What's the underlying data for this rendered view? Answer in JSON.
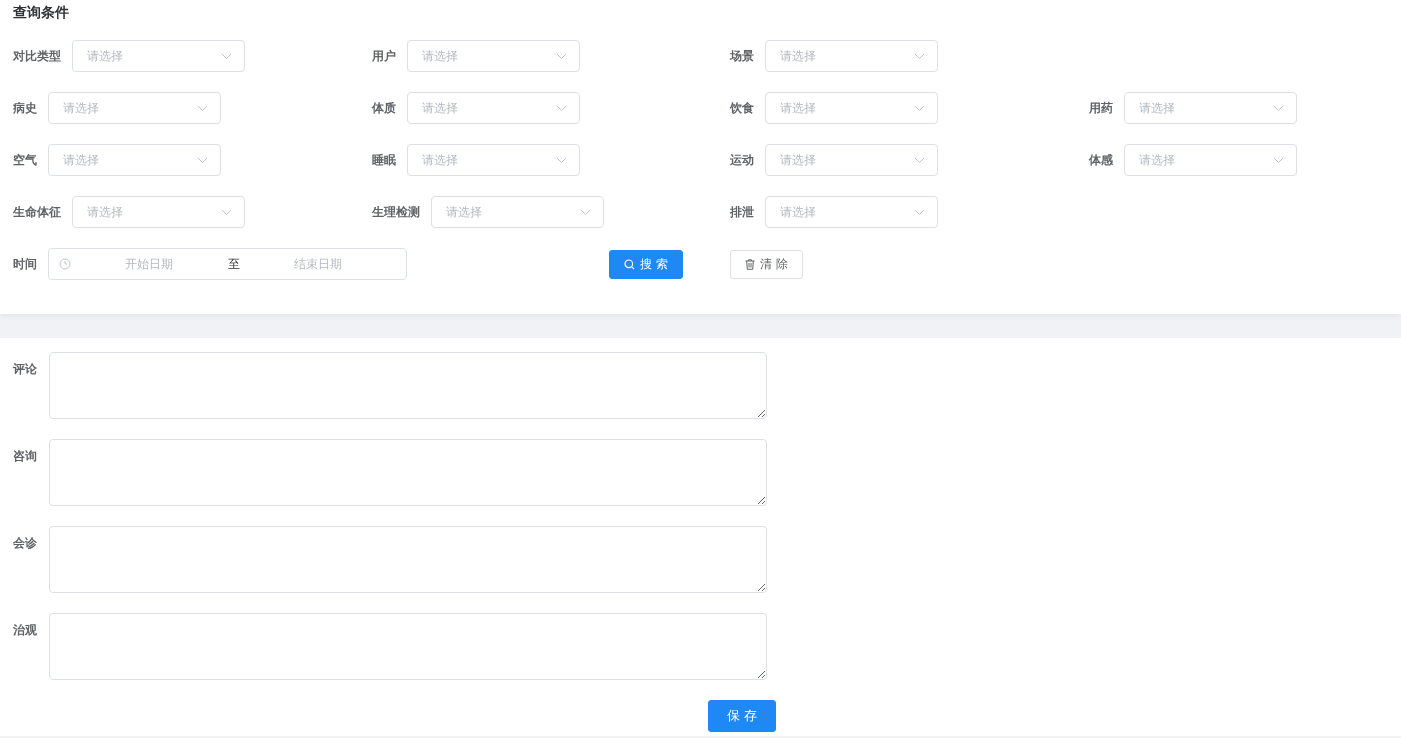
{
  "query_panel": {
    "title": "查询条件",
    "filter_rows": [
      [
        {
          "label": "对比类型",
          "placeholder": "请选择"
        },
        {
          "label": "用户",
          "placeholder": "请选择"
        },
        {
          "label": "场景",
          "placeholder": "请选择"
        }
      ],
      [
        {
          "label": "病史",
          "placeholder": "请选择"
        },
        {
          "label": "体质",
          "placeholder": "请选择"
        },
        {
          "label": "饮食",
          "placeholder": "请选择"
        },
        {
          "label": "用药",
          "placeholder": "请选择"
        }
      ],
      [
        {
          "label": "空气",
          "placeholder": "请选择"
        },
        {
          "label": "睡眠",
          "placeholder": "请选择"
        },
        {
          "label": "运动",
          "placeholder": "请选择"
        },
        {
          "label": "体感",
          "placeholder": "请选择"
        }
      ],
      [
        {
          "label": "生命体征",
          "placeholder": "请选择"
        },
        {
          "label": "生理检测",
          "placeholder": "请选择"
        },
        {
          "label": "排泄",
          "placeholder": "请选择"
        }
      ]
    ],
    "time": {
      "label": "时间",
      "start_placeholder": "开始日期",
      "separator": "至",
      "end_placeholder": "结束日期"
    },
    "search_button": "搜 索",
    "clear_button": "清 除"
  },
  "notes_panel": {
    "fields": [
      {
        "label": "评论"
      },
      {
        "label": "咨询"
      },
      {
        "label": "会诊"
      },
      {
        "label": "治观"
      }
    ],
    "save_button": "保 存"
  }
}
